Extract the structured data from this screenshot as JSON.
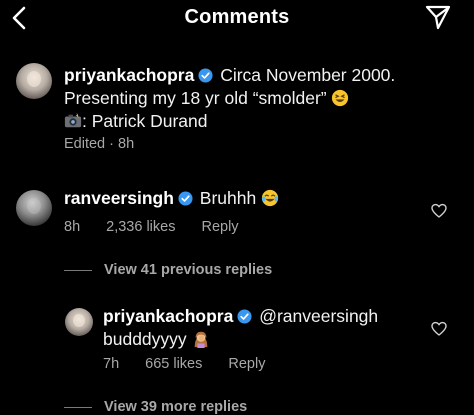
{
  "header": {
    "title": "Comments",
    "back_icon": "chevron-left-icon",
    "share_icon": "paper-plane-icon"
  },
  "comments": [
    {
      "username": "priyankachopra",
      "verified": true,
      "text_line1": "Circa November 2000.",
      "text_line2": "Presenting my 18 yr old “smolder”",
      "text_line3": ": Patrick Durand",
      "emoji_end_line2": "grinning-squinting-face",
      "emoji_start_line3": "camera-with-flash",
      "meta": "Edited · 8h"
    },
    {
      "username": "ranveersingh",
      "verified": true,
      "text": "Bruhhh",
      "emoji": "face-with-tears-of-joy",
      "time": "8h",
      "likes": "2,336 likes",
      "reply": "Reply"
    }
  ],
  "view_previous": "View 41 previous replies",
  "reply_comment": {
    "username": "priyankachopra",
    "verified": true,
    "mention": "@ranveersingh",
    "text": "budddyyyy",
    "emoji": "person-facepalming",
    "time": "7h",
    "likes": "665 likes",
    "reply": "Reply"
  },
  "view_more": "View 39 more replies",
  "colors": {
    "background": "#000000",
    "text": "#ffffff",
    "meta": "#a8a8a8",
    "verified_badge": "#3897f0"
  }
}
